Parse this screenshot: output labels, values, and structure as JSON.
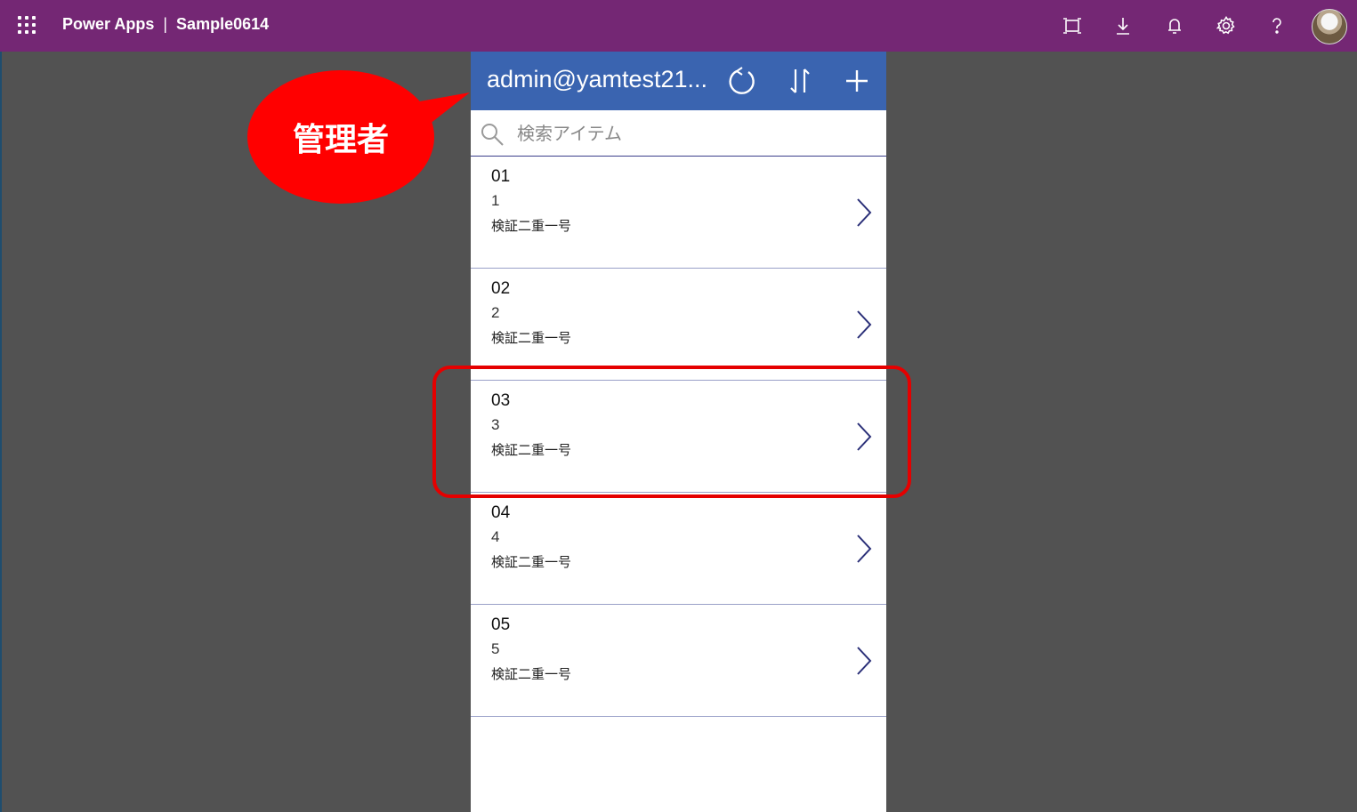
{
  "topbar": {
    "app_name": "Power Apps",
    "separator": "|",
    "app_title": "Sample0614",
    "icons": [
      "waffle-icon",
      "fullscreen-icon",
      "download-icon",
      "bell-icon",
      "gear-icon",
      "help-icon",
      "avatar"
    ],
    "background": "#742774"
  },
  "panel": {
    "header_title": "admin@yamtest21...",
    "header_color": "#3a64b0",
    "header_icons": [
      "refresh-icon",
      "sort-icon",
      "add-icon"
    ],
    "search_placeholder": "検索アイテム",
    "items": [
      {
        "title": "01",
        "number": "1",
        "name": "検証二重一号"
      },
      {
        "title": "02",
        "number": "2",
        "name": "検証二重一号"
      },
      {
        "title": "03",
        "number": "3",
        "name": "検証二重一号"
      },
      {
        "title": "04",
        "number": "4",
        "name": "検証二重一号"
      },
      {
        "title": "05",
        "number": "5",
        "name": "検証二重一号"
      }
    ]
  },
  "annotation": {
    "bubble_label": "管理者",
    "color": "#ff0000"
  }
}
